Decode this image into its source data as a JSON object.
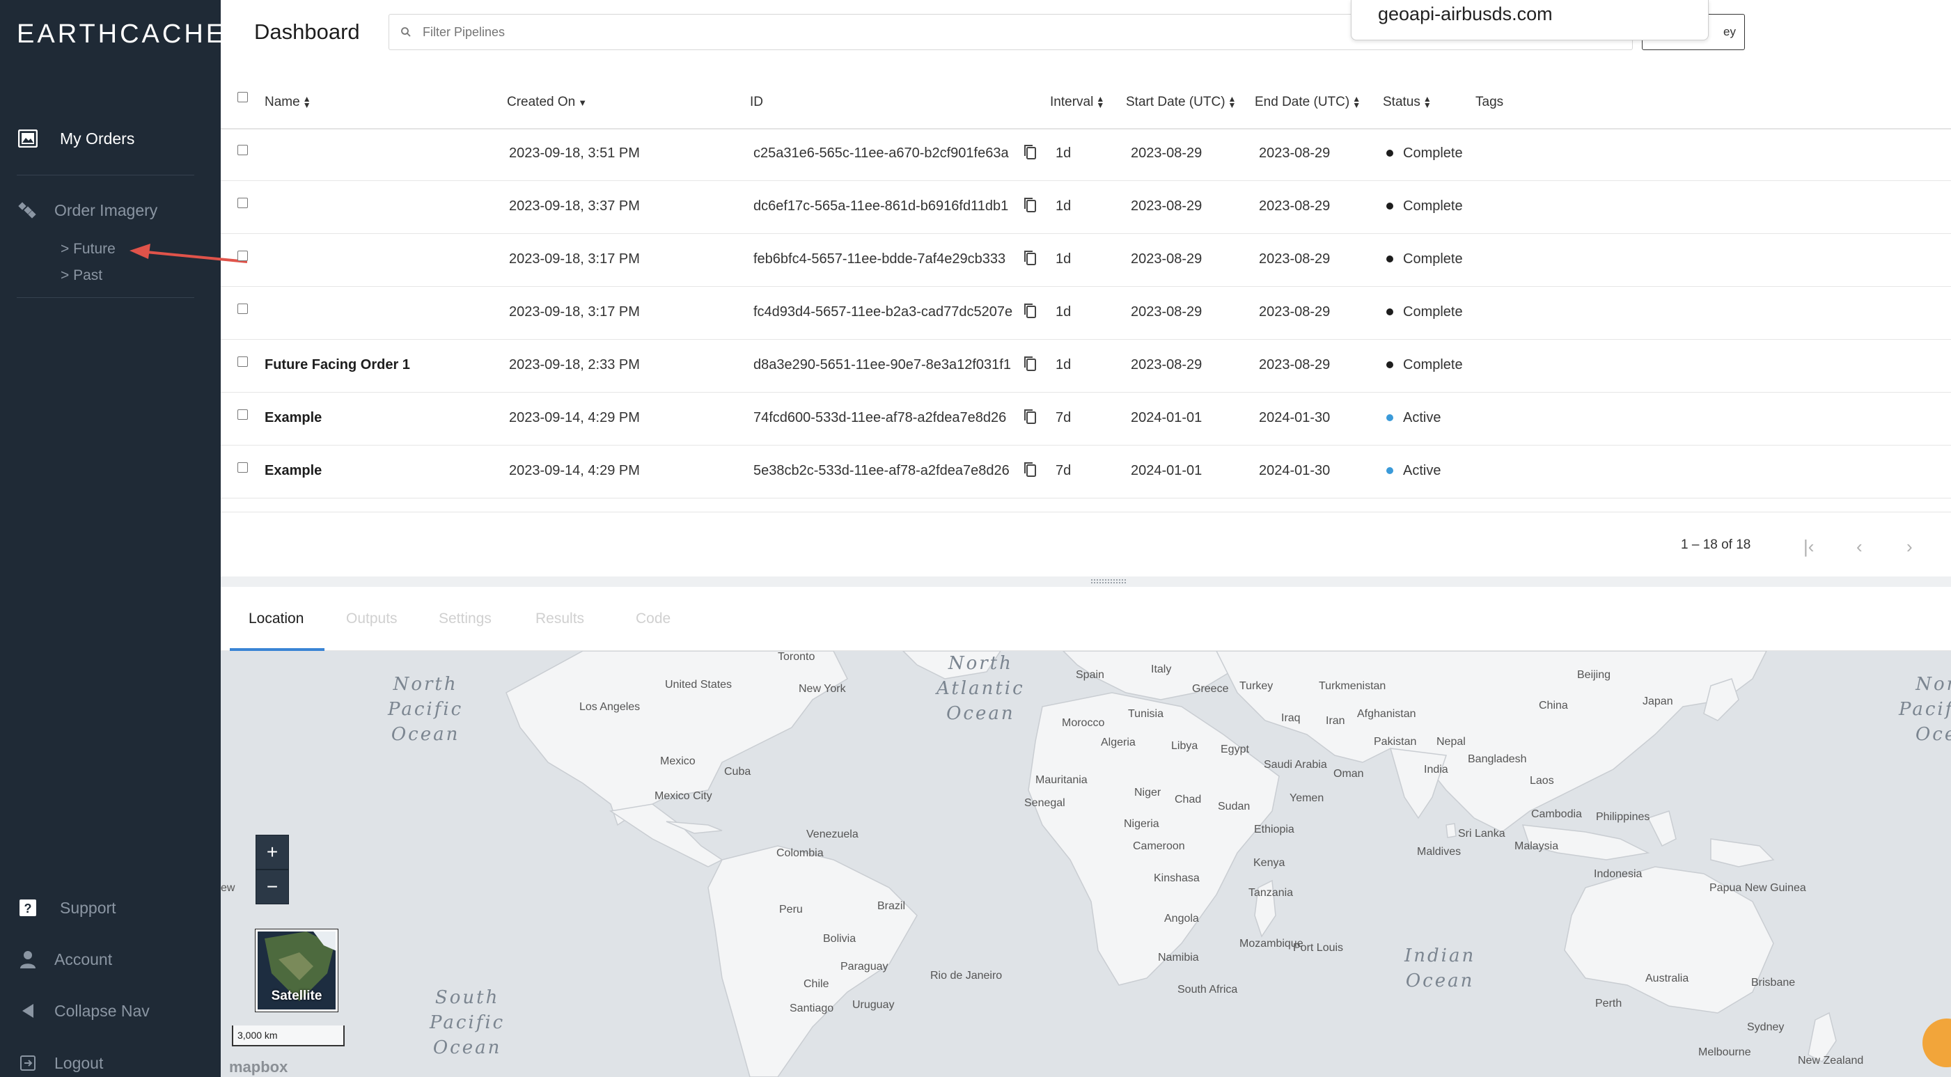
{
  "brand": {
    "logo_text": "EARTHCACHE"
  },
  "sidebar": {
    "my_orders": "My Orders",
    "order_imagery": "Order Imagery",
    "future": "> Future",
    "past": "> Past",
    "support": "Support",
    "account": "Account",
    "collapse_nav": "Collapse Nav",
    "logout": "Logout"
  },
  "header": {
    "title": "Dashboard",
    "filter_placeholder": "Filter Pipelines",
    "button_label": "ey",
    "popup_text": "geoapi-airbusds.com"
  },
  "table": {
    "columns": {
      "name": "Name",
      "created_on": "Created On",
      "id": "ID",
      "interval": "Interval",
      "start_date": "Start Date (UTC)",
      "end_date": "End Date (UTC)",
      "status": "Status",
      "tags": "Tags"
    },
    "rows": [
      {
        "name": "",
        "created": "2023-09-18, 3:51 PM",
        "id": "c25a31e6-565c-11ee-a670-b2cf901fe63a",
        "interval": "1d",
        "start": "2023-08-29",
        "end": "2023-08-29",
        "status": "Complete"
      },
      {
        "name": "",
        "created": "2023-09-18, 3:37 PM",
        "id": "dc6ef17c-565a-11ee-861d-b6916fd11db1",
        "interval": "1d",
        "start": "2023-08-29",
        "end": "2023-08-29",
        "status": "Complete"
      },
      {
        "name": "",
        "created": "2023-09-18, 3:17 PM",
        "id": "feb6bfc4-5657-11ee-bdde-7af4e29cb333",
        "interval": "1d",
        "start": "2023-08-29",
        "end": "2023-08-29",
        "status": "Complete"
      },
      {
        "name": "",
        "created": "2023-09-18, 3:17 PM",
        "id": "fc4d93d4-5657-11ee-b2a3-cad77dc5207e",
        "interval": "1d",
        "start": "2023-08-29",
        "end": "2023-08-29",
        "status": "Complete"
      },
      {
        "name": "Future Facing Order 1",
        "created": "2023-09-18, 2:33 PM",
        "id": "d8a3e290-5651-11ee-90e7-8e3a12f031f1",
        "interval": "1d",
        "start": "2023-08-29",
        "end": "2023-08-29",
        "status": "Complete"
      },
      {
        "name": "Example",
        "created": "2023-09-14, 4:29 PM",
        "id": "74fcd600-533d-11ee-af78-a2fdea7e8d26",
        "interval": "7d",
        "start": "2024-01-01",
        "end": "2024-01-30",
        "status": "Active"
      },
      {
        "name": "Example",
        "created": "2023-09-14, 4:29 PM",
        "id": "5e38cb2c-533d-11ee-af78-a2fdea7e8d26",
        "interval": "7d",
        "start": "2024-01-01",
        "end": "2024-01-30",
        "status": "Active"
      }
    ],
    "pagination": "1 – 18 of 18"
  },
  "tabs": [
    "Location",
    "Outputs",
    "Settings",
    "Results",
    "Code"
  ],
  "map": {
    "oceans": {
      "north_pacific": "North\nPacific\nOcean",
      "north_atlantic": "North\nAtlantic\nOcean",
      "south_pacific": "South\nPacific\nOcean",
      "indian": "Indian\nOcean",
      "north_pacific_right": "Nor\nPacific\nOce"
    },
    "labels": [
      "Toronto",
      "United States",
      "New York",
      "Los Angeles",
      "Mexico",
      "Mexico City",
      "Cuba",
      "Venezuela",
      "Colombia",
      "Peru",
      "Brazil",
      "Bolivia",
      "Paraguay",
      "Chile",
      "Santiago",
      "Uruguay",
      "Rio de Janeiro",
      "Spain",
      "Italy",
      "Greece",
      "Turkey",
      "Turkmenistan",
      "Beijing",
      "China",
      "Japan",
      "Morocco",
      "Tunisia",
      "Algeria",
      "Libya",
      "Egypt",
      "Iraq",
      "Iran",
      "Afghanistan",
      "Pakistan",
      "Nepal",
      "Bangladesh",
      "India",
      "Laos",
      "Saudi Arabia",
      "Oman",
      "Mauritania",
      "Niger",
      "Chad",
      "Sudan",
      "Senegal",
      "Nigeria",
      "Ethiopia",
      "Yemen",
      "Cameroon",
      "Kenya",
      "Kinshasa",
      "Tanzania",
      "Angola",
      "Mozambique",
      "Namibia",
      "South Africa",
      "Port Louis",
      "Sri Lanka",
      "Maldives",
      "Cambodia",
      "Philippines",
      "Malaysia",
      "Indonesia",
      "Papua New Guinea",
      "Australia",
      "Brisbane",
      "Perth",
      "Sydney",
      "Melbourne",
      "New Zealand",
      "ew"
    ],
    "zoom_in": "+",
    "zoom_out": "−",
    "satellite_label": "Satellite",
    "scale": "3,000 km",
    "attribution": "mapbox"
  },
  "colors": {
    "sidebar_bg": "#1f2a36",
    "complete_dot": "#1d1d1d",
    "active_dot": "#3a9ad9",
    "tab_accent": "#3a84d4",
    "annotation_arrow": "#e0534a"
  }
}
